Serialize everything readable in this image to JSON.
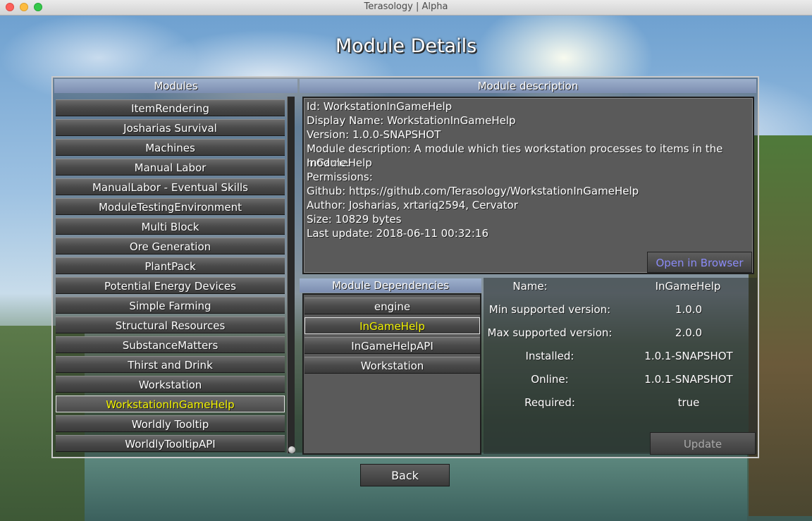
{
  "window": {
    "title": "Terasology | Alpha"
  },
  "screen_title": "Module Details",
  "modules_panel": {
    "header": "Modules",
    "items": [
      "ItemRendering",
      "Josharias Survival",
      "Machines",
      "Manual Labor",
      "ManualLabor - Eventual Skills",
      "ModuleTestingEnvironment",
      "Multi Block",
      "Ore Generation",
      "PlantPack",
      "Potential Energy Devices",
      "Simple Farming",
      "Structural Resources",
      "SubstanceMatters",
      "Thirst and Drink",
      "Workstation",
      "WorkstationInGameHelp",
      "Worldly Tooltip",
      "WorldlyTooltipAPI"
    ],
    "selected": "WorkstationInGameHelp"
  },
  "description_panel": {
    "header": "Module description",
    "lines": [
      "Id: WorkstationInGameHelp",
      "Display Name: WorkstationInGameHelp",
      "Version: 1.0.0-SNAPSHOT",
      "Module description: A module which ties workstation processes to items in the InGameHelp",
      "module.",
      "Permissions:",
      "Github: https://github.com/Terasology/WorkstationInGameHelp",
      "Author: Josharias, xrtariq2594, Cervator",
      "Size: 10829 bytes",
      "Last update: 2018-06-11 00:32:16"
    ],
    "open_browser_label": "Open in Browser"
  },
  "dependencies_panel": {
    "header": "Module Dependencies",
    "items": [
      "engine",
      "InGameHelp",
      "InGameHelpAPI",
      "Workstation"
    ],
    "selected": "InGameHelp"
  },
  "dependency_details": {
    "name_label": "Name:",
    "name_value": "InGameHelp",
    "min_label": "Min supported version:",
    "min_value": "1.0.0",
    "max_label": "Max supported version:",
    "max_value": "2.0.0",
    "installed_label": "Installed:",
    "installed_value": "1.0.1-SNAPSHOT",
    "online_label": "Online:",
    "online_value": "1.0.1-SNAPSHOT",
    "required_label": "Required:",
    "required_value": "true",
    "update_label": "Update"
  },
  "back_label": "Back",
  "colors": {
    "selected_text": "#f4f400",
    "link_text": "#8a8af5",
    "header_bg": "#8a9cbe"
  }
}
